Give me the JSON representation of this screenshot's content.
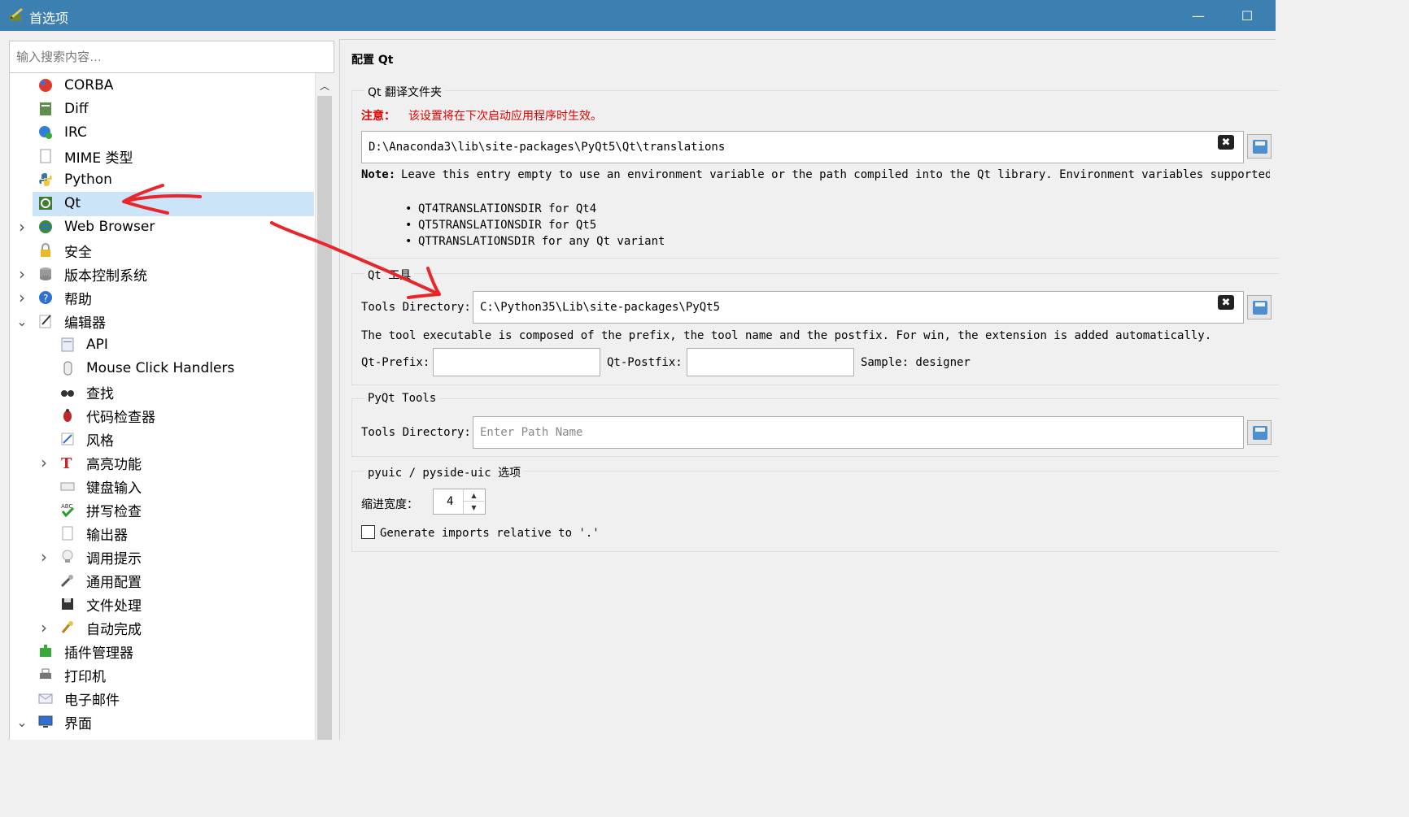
{
  "window": {
    "title": "首选项",
    "minimize_glyph": "—",
    "maximize_glyph": "☐"
  },
  "search": {
    "placeholder": "输入搜索内容…"
  },
  "tree": {
    "items": [
      {
        "label": "CORBA",
        "icon": "corba-icon",
        "level": 0,
        "chevron": ""
      },
      {
        "label": "Diff",
        "icon": "diff-icon",
        "level": 0,
        "chevron": ""
      },
      {
        "label": "IRC",
        "icon": "irc-icon",
        "level": 0,
        "chevron": ""
      },
      {
        "label": "MIME 类型",
        "icon": "mime-icon",
        "level": 0,
        "chevron": ""
      },
      {
        "label": "Python",
        "icon": "python-icon",
        "level": 0,
        "chevron": ""
      },
      {
        "label": "Qt",
        "icon": "qt-icon",
        "level": 0,
        "chevron": "",
        "selected": true
      },
      {
        "label": "Web Browser",
        "icon": "globe-icon",
        "level": 0,
        "chevron": ">"
      },
      {
        "label": "安全",
        "icon": "lock-icon",
        "level": 0,
        "chevron": ""
      },
      {
        "label": "版本控制系统",
        "icon": "database-icon",
        "level": 0,
        "chevron": ">"
      },
      {
        "label": "帮助",
        "icon": "help-icon",
        "level": 0,
        "chevron": ">"
      },
      {
        "label": "编辑器",
        "icon": "editor-icon",
        "level": 0,
        "chevron": "v"
      },
      {
        "label": "API",
        "icon": "api-icon",
        "level": 1,
        "chevron": ""
      },
      {
        "label": "Mouse Click Handlers",
        "icon": "mouse-icon",
        "level": 1,
        "chevron": ""
      },
      {
        "label": "查找",
        "icon": "binoculars-icon",
        "level": 1,
        "chevron": ""
      },
      {
        "label": "代码检查器",
        "icon": "bug-icon",
        "level": 1,
        "chevron": ""
      },
      {
        "label": "风格",
        "icon": "style-icon",
        "level": 1,
        "chevron": ""
      },
      {
        "label": "高亮功能",
        "icon": "highlight-icon",
        "level": 1,
        "chevron": ">"
      },
      {
        "label": "键盘输入",
        "icon": "keyboard-icon",
        "level": 1,
        "chevron": ""
      },
      {
        "label": "拼写检查",
        "icon": "spellcheck-icon",
        "level": 1,
        "chevron": ""
      },
      {
        "label": "输出器",
        "icon": "exporter-icon",
        "level": 1,
        "chevron": ""
      },
      {
        "label": "调用提示",
        "icon": "lightbulb-icon",
        "level": 1,
        "chevron": ">"
      },
      {
        "label": "通用配置",
        "icon": "wrench-icon",
        "level": 1,
        "chevron": ""
      },
      {
        "label": "文件处理",
        "icon": "save-icon",
        "level": 1,
        "chevron": ""
      },
      {
        "label": "自动完成",
        "icon": "autocomplete-icon",
        "level": 1,
        "chevron": ">"
      },
      {
        "label": "插件管理器",
        "icon": "plugin-icon",
        "level": 0,
        "chevron": ""
      },
      {
        "label": "打印机",
        "icon": "printer-icon",
        "level": 0,
        "chevron": ""
      },
      {
        "label": "电子邮件",
        "icon": "email-icon",
        "level": 0,
        "chevron": ""
      },
      {
        "label": "界面",
        "icon": "monitor-icon",
        "level": 0,
        "chevron": "v"
      }
    ]
  },
  "page": {
    "title": "配置 Qt",
    "translations_group": {
      "title": "Qt 翻译文件夹",
      "warning_label": "注意：",
      "warning_text": "该设置将在下次启动应用程序时生效。",
      "path_value": "D:\\Anaconda3\\lib\\site-packages\\PyQt5\\Qt\\translations",
      "note_label": "Note:",
      "note_text": "Leave this entry empty to use an environment variable or the path compiled into the Qt library. Environment variables supported are",
      "bullets": [
        "QT4TRANSLATIONSDIR for Qt4",
        "QT5TRANSLATIONSDIR for Qt5",
        "QTTRANSLATIONSDIR for any Qt variant"
      ]
    },
    "qt_tools_group": {
      "title": "Qt 工具",
      "tools_dir_label": "Tools Directory:",
      "tools_dir_value": "C:\\Python35\\Lib\\site-packages\\PyQt5",
      "description": "The tool executable is composed of the prefix, the tool name and the postfix. For win, the extension is added automatically.",
      "prefix_label": "Qt-Prefix:",
      "prefix_value": "",
      "postfix_label": "Qt-Postfix:",
      "postfix_value": "",
      "sample_text": "Sample: designer"
    },
    "pyqt_tools_group": {
      "title": "PyQt Tools",
      "tools_dir_label": "Tools Directory:",
      "tools_dir_placeholder": "Enter Path Name"
    },
    "pyuic_group": {
      "title": "pyuic / pyside-uic 选项",
      "indent_label": "缩进宽度：",
      "indent_value": "4",
      "generate_imports_label": "Generate imports relative to '.'",
      "generate_imports_checked": false
    },
    "clear_glyph": "✖",
    "spin_up_glyph": "▲",
    "spin_down_glyph": "▼",
    "scroll_up_glyph": "︿"
  },
  "colors": {
    "titlebar": "#3c7fb1",
    "selection": "#cce4f7",
    "warning": "#e00000",
    "annotation": "#e8262b"
  }
}
